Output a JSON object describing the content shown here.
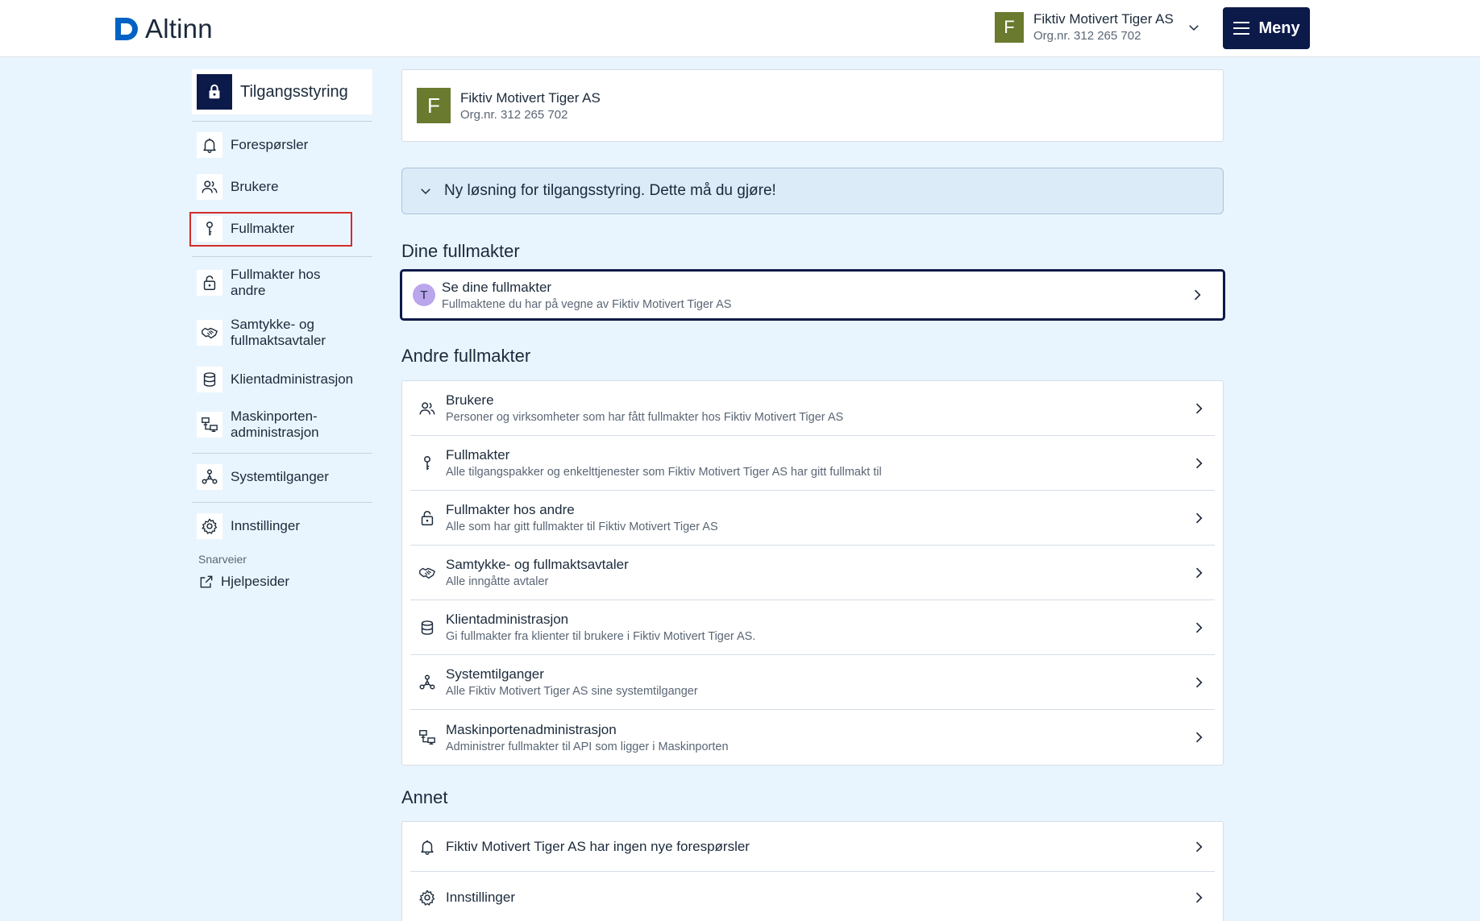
{
  "header": {
    "logo_text": "Altinn",
    "account_name": "Fiktiv Motivert Tiger AS",
    "account_org": "Org.nr. 312 265 702",
    "account_initial": "F",
    "menu_label": "Meny"
  },
  "sidebar": {
    "title": "Tilgangsstyring",
    "items": [
      {
        "label": "Forespørsler",
        "icon": "bell-icon"
      },
      {
        "label": "Brukere",
        "icon": "users-icon"
      },
      {
        "label": "Fullmakter",
        "icon": "key-icon"
      },
      {
        "label": "Fullmakter hos andre",
        "icon": "lock-icon"
      },
      {
        "label": "Samtykke- og fullmaktsavtaler",
        "icon": "handshake-icon"
      },
      {
        "label": "Klientadministrasjon",
        "icon": "database-icon"
      },
      {
        "label": "Maskinporten-administrasjon",
        "icon": "network-icon"
      },
      {
        "label": "Systemtilganger",
        "icon": "nodes-icon"
      },
      {
        "label": "Innstillinger",
        "icon": "gear-icon"
      }
    ],
    "shortcuts_label": "Snarveier",
    "help_label": "Hjelpesider"
  },
  "org_card": {
    "initial": "F",
    "name": "Fiktiv Motivert Tiger AS",
    "org": "Org.nr. 312 265 702"
  },
  "notice": {
    "text": "Ny løsning for tilgangsstyring. Dette må du gjøre!"
  },
  "dine": {
    "heading": "Dine fullmakter",
    "avatar": "T",
    "title": "Se dine fullmakter",
    "subtitle": "Fullmaktene du har på vegne av Fiktiv Motivert Tiger AS"
  },
  "andre": {
    "heading": "Andre fullmakter",
    "rows": [
      {
        "title": "Brukere",
        "subtitle": "Personer og virksomheter som har fått fullmakter hos Fiktiv Motivert Tiger AS",
        "icon": "users-icon"
      },
      {
        "title": "Fullmakter",
        "subtitle": "Alle tilgangspakker og enkelttjenester som Fiktiv Motivert Tiger AS har gitt fullmakt til",
        "icon": "key-icon"
      },
      {
        "title": "Fullmakter hos andre",
        "subtitle": "Alle som har gitt fullmakter til Fiktiv Motivert Tiger AS",
        "icon": "lock-icon"
      },
      {
        "title": "Samtykke- og fullmaktsavtaler",
        "subtitle": "Alle inngåtte avtaler",
        "icon": "handshake-icon"
      },
      {
        "title": "Klientadministrasjon",
        "subtitle": "Gi fullmakter fra klienter til brukere i Fiktiv Motivert Tiger AS.",
        "icon": "database-icon"
      },
      {
        "title": "Systemtilganger",
        "subtitle": "Alle Fiktiv Motivert Tiger AS sine systemtilganger",
        "icon": "nodes-icon"
      },
      {
        "title": "Maskinportenadministrasjon",
        "subtitle": "Administrer fullmakter til API som ligger i Maskinporten",
        "icon": "network-icon"
      }
    ]
  },
  "annet": {
    "heading": "Annet",
    "rows": [
      {
        "title": "Fiktiv Motivert Tiger AS har ingen nye forespørsler",
        "icon": "bell-icon"
      },
      {
        "title": "Innstillinger",
        "icon": "gear-icon"
      }
    ]
  },
  "colors": {
    "navy": "#0c1a4a",
    "org_avatar": "#6a7a2e",
    "background": "#e9f5fe",
    "highlight": "#d62b2b"
  }
}
